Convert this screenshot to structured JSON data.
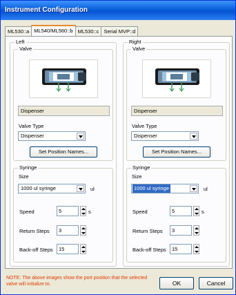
{
  "window": {
    "title": "Instrument Configuration"
  },
  "tabs": [
    {
      "label": "ML530::a"
    },
    {
      "label": "ML540/ML560::b"
    },
    {
      "label": "ML530::c"
    },
    {
      "label": "Serial MVP::d"
    }
  ],
  "left": {
    "legend": "Left",
    "valve": {
      "legend": "Valve",
      "name": "Dispenser",
      "type_label": "Valve Type",
      "type_value": "Dispenser",
      "set_names_button": "Set Position Names..."
    },
    "syringe": {
      "legend": "Syringe",
      "size_label": "Size",
      "size_value": "1000 ul syringe",
      "size_unit": "ul",
      "speed_label": "Speed",
      "speed_value": "5",
      "speed_unit": "s",
      "return_label": "Return Steps",
      "return_value": "3",
      "backoff_label": "Back-off Steps",
      "backoff_value": "15"
    }
  },
  "right": {
    "legend": "Right",
    "valve": {
      "legend": "Valve",
      "name": "Dispenser",
      "type_label": "Valve Type",
      "type_value": "Dispenser",
      "set_names_button": "Set Position Names..."
    },
    "syringe": {
      "legend": "Syringe",
      "size_label": "Size",
      "size_value": "1000 ul syringe",
      "size_unit": "ul",
      "speed_label": "Speed",
      "speed_value": "5",
      "speed_unit": "s",
      "return_label": "Return Steps",
      "return_value": "3",
      "backoff_label": "Back-off Steps",
      "backoff_value": "15"
    }
  },
  "footer": {
    "note": "NOTE: The above images show the port position that the selected valve will initialize to.",
    "ok_label": "OK",
    "cancel_label": "Cancel"
  }
}
